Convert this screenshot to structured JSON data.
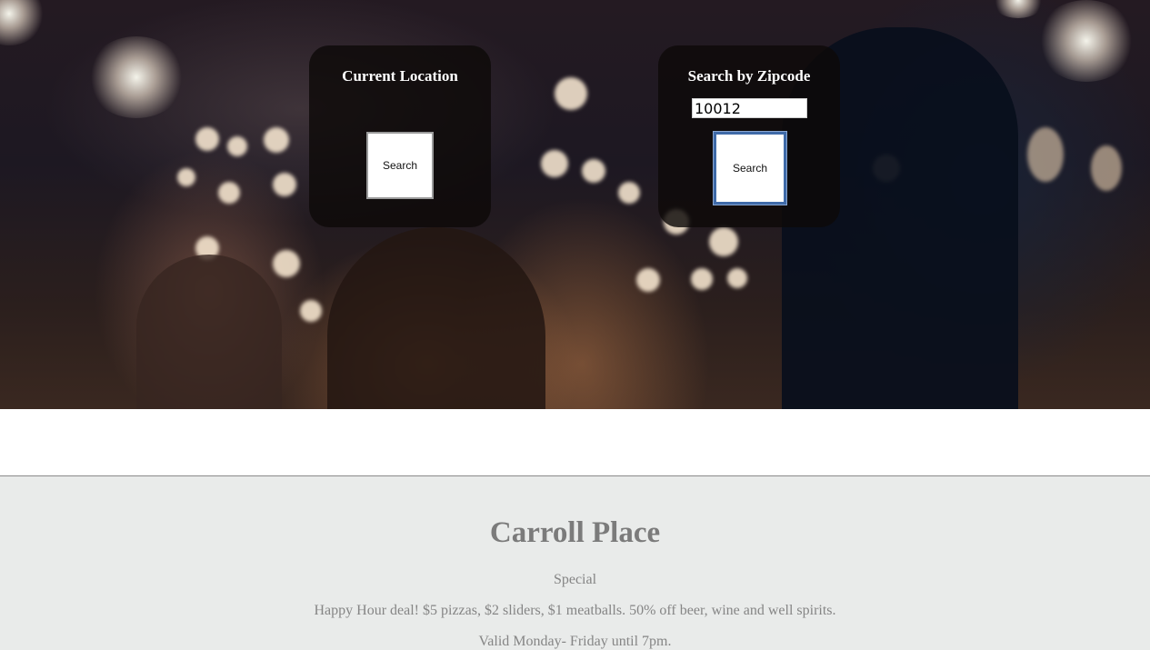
{
  "current_location_panel": {
    "title": "Current Location",
    "search_button_label": "Search"
  },
  "zipcode_panel": {
    "title": "Search by Zipcode",
    "zipcode_value": "10012",
    "search_button_label": "Search"
  },
  "venue": {
    "name": "Carroll Place",
    "special_heading": "Special",
    "deal_text": "Happy Hour deal! $5 pizzas, $2 sliders, $1 meatballs. 50% off beer, wine and well spirits.",
    "validity_text": "Valid Monday- Friday until 7pm."
  },
  "colors": {
    "panel_background": "#0e0a08",
    "info_background": "#e9ebea",
    "info_text": "#808080",
    "focus_ring": "#3f6aa8"
  }
}
